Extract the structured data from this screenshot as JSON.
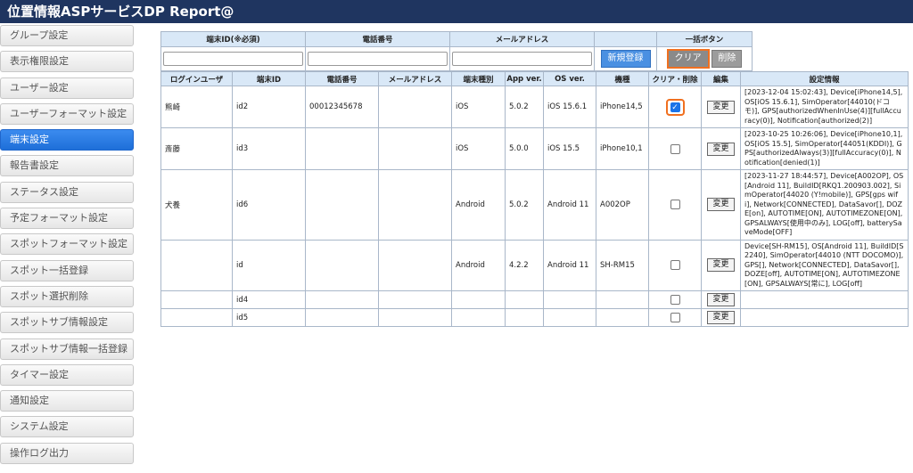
{
  "header": {
    "title": "位置情報ASPサービスDP Report@"
  },
  "sidebar": {
    "items": [
      "グループ設定",
      "表示権限設定",
      "ユーザー設定",
      "ユーザーフォーマット設定",
      "端末設定",
      "報告書設定",
      "ステータス設定",
      "予定フォーマット設定",
      "スポットフォーマット設定",
      "スポット一括登録",
      "スポット選択削除",
      "スポットサブ情報設定",
      "スポットサブ情報一括登録",
      "タイマー設定",
      "通知設定",
      "システム設定",
      "操作ログ出力"
    ],
    "active_index": 4
  },
  "search": {
    "col_terminal_id": "端末ID(※必須)",
    "col_phone": "電話番号",
    "col_mail": "メールアドレス",
    "col_bulk": "一括ボタン",
    "btn_new": "新規登録",
    "btn_clear": "クリア",
    "btn_delete": "削除"
  },
  "list": {
    "headers": [
      "ログインユーザ",
      "端末ID",
      "電話番号",
      "メールアドレス",
      "端末種別",
      "App ver.",
      "OS ver.",
      "機種",
      "クリア・削除",
      "編集",
      "設定情報"
    ],
    "change_label": "変更",
    "rows": [
      {
        "user": "熊崎",
        "id": "id2",
        "phone": "00012345678",
        "mail": "",
        "type": "iOS",
        "app": "5.0.2",
        "os": "iOS 15.6.1",
        "model": "iPhone14,5",
        "checked": true,
        "info": "[2023-12-04 15:02:43], Device[iPhone14,5], OS[iOS 15.6.1], SimOperator[44010(ドコモ)], GPS[authorizedWhenInUse(4)][fullAccuracy(0)], Notification[authorized(2)]"
      },
      {
        "user": "斎藤",
        "id": "id3",
        "phone": "",
        "mail": "",
        "type": "iOS",
        "app": "5.0.0",
        "os": "iOS 15.5",
        "model": "iPhone10,1",
        "checked": false,
        "info": "[2023-10-25 10:26:06], Device[iPhone10,1], OS[iOS 15.5], SimOperator[44051(KDDI)], GPS[authorizedAlways(3)][fullAccuracy(0)], Notification[denied(1)]"
      },
      {
        "user": "犬養",
        "id": "id6",
        "phone": "",
        "mail": "",
        "type": "Android",
        "app": "5.0.2",
        "os": "Android 11",
        "model": "A002OP",
        "checked": false,
        "info": "[2023-11-27 18:44:57], Device[A002OP], OS[Android 11], BuildID[RKQ1.200903.002], SimOperator[44020 (Y!mobile)], GPS[gps wifi], Network[CONNECTED], DataSavor[], DOZE[on], AUTOTIME[ON], AUTOTIMEZONE[ON], GPSALWAYS[使用中のみ], LOG[off], batterySaveMode[OFF]"
      },
      {
        "user": "",
        "id": "id",
        "phone": "",
        "mail": "",
        "type": "Android",
        "app": "4.2.2",
        "os": "Android 11",
        "model": "SH-RM15",
        "checked": false,
        "info": "Device[SH-RM15], OS[Android 11], BuildID[S2240], SimOperator[44010 (NTT DOCOMO)], GPS[], Network[CONNECTED], DataSavor[], DOZE[off], AUTOTIME[ON], AUTOTIMEZONE[ON], GPSALWAYS[常に], LOG[off]"
      },
      {
        "user": "",
        "id": "id4",
        "phone": "",
        "mail": "",
        "type": "",
        "app": "",
        "os": "",
        "model": "",
        "checked": false,
        "info": ""
      },
      {
        "user": "",
        "id": "id5",
        "phone": "",
        "mail": "",
        "type": "",
        "app": "",
        "os": "",
        "model": "",
        "checked": false,
        "info": ""
      }
    ]
  }
}
